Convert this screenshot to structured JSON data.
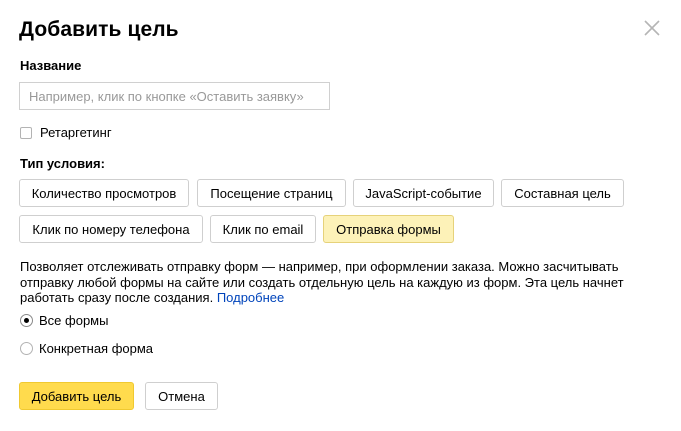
{
  "dialog": {
    "title": "Добавить цель",
    "close_icon": "close-icon"
  },
  "name_field": {
    "label": "Название",
    "value": "",
    "placeholder": "Например, клик по кнопке «Оставить заявку»"
  },
  "retargeting": {
    "label": "Ретаргетинг",
    "checked": false
  },
  "condition_type": {
    "label": "Тип условия:",
    "options": [
      {
        "label": "Количество просмотров",
        "selected": false
      },
      {
        "label": "Посещение страниц",
        "selected": false
      },
      {
        "label": "JavaScript-событие",
        "selected": false
      },
      {
        "label": "Составная цель",
        "selected": false
      },
      {
        "label": "Клик по номеру телефона",
        "selected": false
      },
      {
        "label": "Клик по email",
        "selected": false
      },
      {
        "label": "Отправка формы",
        "selected": true
      }
    ]
  },
  "description": {
    "line1": "Позволяет отслеживать отправку форм — например, при оформлении заказа. Можно засчитывать",
    "line2": "отправку любой формы на сайте или создать отдельную цель на каждую из форм. Эта цель начнет",
    "line3": "работать сразу после создания.",
    "link": "Подробнее"
  },
  "form_scope": {
    "options": [
      {
        "label": "Все формы",
        "checked": true
      },
      {
        "label": "Конкретная форма",
        "checked": false
      }
    ]
  },
  "actions": {
    "submit_label": "Добавить цель",
    "cancel_label": "Отмена"
  },
  "colors": {
    "selected_option_bg": "#fdf2b8",
    "primary_button_bg": "#ffdb4d",
    "link": "#0044bb"
  }
}
